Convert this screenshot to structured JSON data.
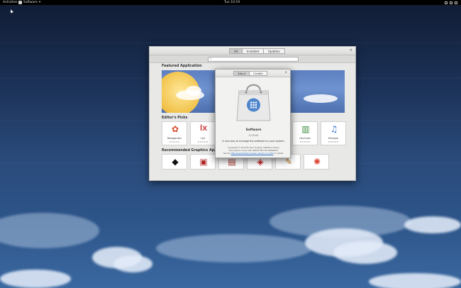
{
  "topbar": {
    "activities": "Activities",
    "app_menu": "Software",
    "app_menu_arrow": "▾",
    "clock": "Tue 10:19"
  },
  "window": {
    "mode_buttons": [
      "All",
      "Installed",
      "Updates"
    ],
    "close": "×",
    "search_placeholder": "",
    "sections": {
      "featured": "Featured Application",
      "editors_picks": "Editor's Picks",
      "recommended_graphics": "Recommended Graphics Applications"
    },
    "editors_picks": [
      {
        "name": "Rosegarden",
        "stars": "★★★★★",
        "icon": "rosegarden-icon"
      },
      {
        "name": "LyX",
        "stars": "★★★★★",
        "icon": "lyx-icon"
      },
      {
        "name": "GnuCash",
        "stars": "★★★★★",
        "icon": "gnucash-icon"
      },
      {
        "name": "Musique",
        "stars": "★★★★★",
        "icon": "musique-icon"
      }
    ],
    "recommended_graphics_icons": [
      "inkscape-icon",
      "scribus-icon",
      "shotwell-icon",
      "krita-icon",
      "mypaint-icon",
      "darktable-icon"
    ]
  },
  "about": {
    "tabs": [
      "About",
      "Credits"
    ],
    "close": "×",
    "app_name": "Software",
    "version": "3.13.91",
    "description": "A nice way to manage the software on your system.",
    "copyright": "Copyright © 2013 Richard Hughes, Matthias Clasen",
    "warranty": "This program comes with ABSOLUTELY NO WARRANTY.",
    "license_prefix": "See the",
    "license_link": "GNU General Public License, version 2 or later",
    "license_suffix": "for details."
  },
  "colors": {
    "desktop_top": "#101c33",
    "desktop_bottom": "#3a68a0",
    "topbar": "#000000",
    "window_bg": "#e8e8e7",
    "featured_banner": "#6f93d0",
    "moon": "#f1c24a",
    "bag_badge": "#4e86cc"
  }
}
